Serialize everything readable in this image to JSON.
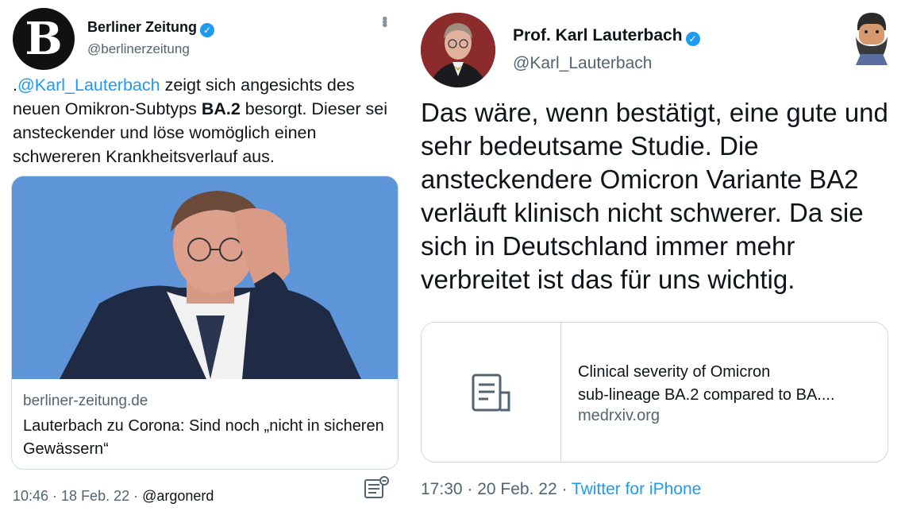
{
  "left_tweet": {
    "author_name": "Berliner Zeitung",
    "author_handle": "@berlinerzeitung",
    "avatar_letter": "B",
    "text_prefix": ".",
    "mention": "@Karl_Lauterbach",
    "text_part1": " zeigt sich angesichts des neuen Omikron-Subtyps ",
    "text_bold": "BA.2",
    "text_part2": " besorgt. Dieser sei ansteckender und löse womöglich einen schwereren Krankheitsverlauf aus.",
    "card": {
      "domain": "berliner-zeitung.de",
      "title": "Lauterbach zu Corona: Sind noch „nicht in sicheren Gewässern“"
    },
    "timestamp": "10:46 · 18 Feb. 22 · ",
    "watermark_handle": "@argonerd"
  },
  "right_tweet": {
    "author_name": "Prof. Karl Lauterbach",
    "author_handle": "@Karl_Lauterbach",
    "text": "Das wäre, wenn bestätigt, eine gute und sehr bedeutsame Studie. Die ansteckendere Omicron Variante BA2 verläuft klinisch nicht schwerer. Da sie sich in Deutschland immer mehr verbreitet ist das für uns wichtig.",
    "card": {
      "title_line1": "Clinical severity of Omicron",
      "title_line2": "sub-lineage BA.2 compared to BA....",
      "domain": "medrxiv.org"
    },
    "timestamp": "17:30 · 20 Feb. 22 · ",
    "source": "Twitter for iPhone"
  },
  "colors": {
    "link_blue": "#1d9bf0",
    "text_primary": "#0f1419",
    "text_secondary": "#536471",
    "border": "#cfd9de"
  }
}
